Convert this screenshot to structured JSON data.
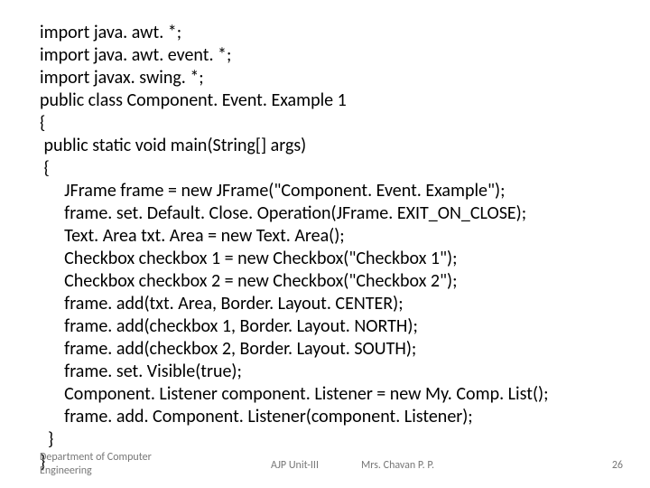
{
  "code": {
    "l01": "import java. awt. *;",
    "l02": "import java. awt. event. *;",
    "l03": "import javax. swing. *;",
    "l04": "",
    "l05": "public class Component. Event. Example 1",
    "l06": "{",
    "l07": " public static void main(String[] args)",
    "l08": " {",
    "l09": "      JFrame frame = new JFrame(\"Component. Event. Example\");",
    "l10": "      frame. set. Default. Close. Operation(JFrame. EXIT_ON_CLOSE);",
    "l11": "      Text. Area txt. Area = new Text. Area();",
    "l12": "      Checkbox checkbox 1 = new Checkbox(\"Checkbox 1\");",
    "l13": "      Checkbox checkbox 2 = new Checkbox(\"Checkbox 2\");",
    "l14": "      frame. add(txt. Area, Border. Layout. CENTER);",
    "l15": "      frame. add(checkbox 1, Border. Layout. NORTH);",
    "l16": "      frame. add(checkbox 2, Border. Layout. SOUTH);",
    "l17": "      frame. set. Visible(true);",
    "l18": "      Component. Listener component. Listener = new My. Comp. List();",
    "l19": "      frame. add. Component. Listener(component. Listener);",
    "l20": "  }",
    "l21": "}"
  },
  "footer": {
    "dept": "Department of Computer Engineering",
    "unit": "AJP Unit-III",
    "author": "Mrs. Chavan P. P.",
    "pageno": "26"
  }
}
